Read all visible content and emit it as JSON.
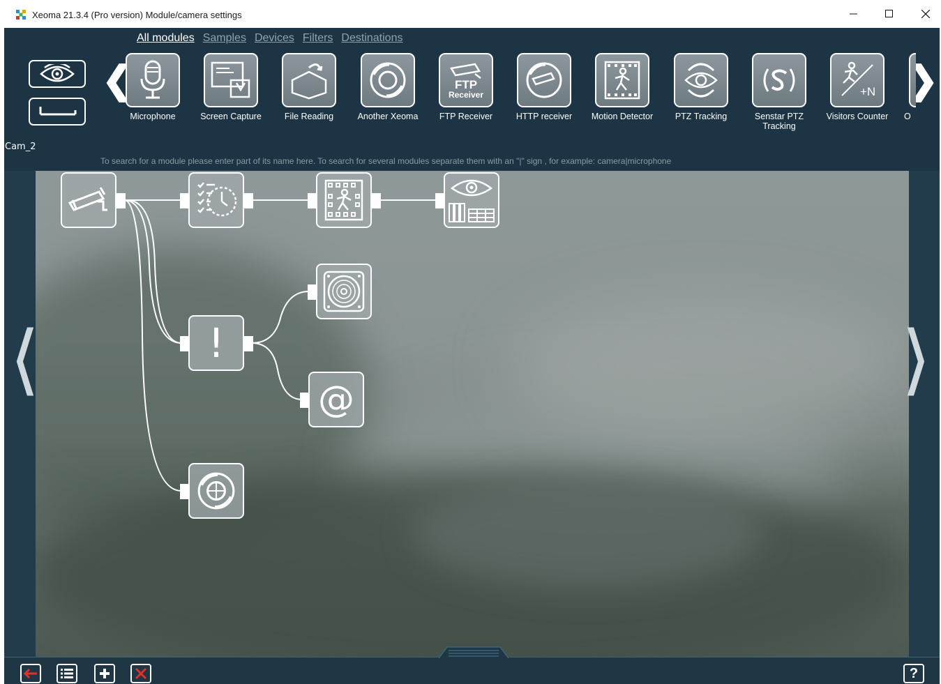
{
  "window": {
    "title": "Xeoma 21.3.4 (Pro version) Module/camera settings",
    "min_glyph": "–",
    "max_glyph": "☐",
    "close_glyph": "✕"
  },
  "tabs": [
    {
      "label": "All modules",
      "active": true
    },
    {
      "label": "Samples",
      "active": false
    },
    {
      "label": "Devices",
      "active": false
    },
    {
      "label": "Filters",
      "active": false
    },
    {
      "label": "Destinations",
      "active": false
    }
  ],
  "camera_name": "Cam_2",
  "modules": [
    {
      "label": "Microphone",
      "icon": "microphone-icon"
    },
    {
      "label": "Screen Capture",
      "icon": "screen-capture-icon"
    },
    {
      "label": "File Reading",
      "icon": "file-reading-icon"
    },
    {
      "label": "Another Xeoma",
      "icon": "another-xeoma-icon"
    },
    {
      "label": "FTP Receiver",
      "icon": "ftp-receiver-icon"
    },
    {
      "label": "HTTP receiver",
      "icon": "http-receiver-icon"
    },
    {
      "label": "Motion Detector",
      "icon": "motion-detector-icon"
    },
    {
      "label": "PTZ Tracking",
      "icon": "ptz-tracking-icon"
    },
    {
      "label": "Senstar PTZ Tracking",
      "icon": "senstar-ptz-icon"
    },
    {
      "label": "Visitors Counter",
      "icon": "visitors-counter-icon"
    },
    {
      "label": "O",
      "icon": "partial-module-icon"
    }
  ],
  "ftp_icon_text": {
    "line1": "FTP",
    "line2": "Receiver"
  },
  "visitors_icon_text": "+N",
  "search_hint": "To search for a module please enter part of its name here. To search for several modules separate them with an \"|\" sign , for example: camera|microphone",
  "graph_nodes": [
    {
      "name": "camera-node",
      "icon": "camera-icon"
    },
    {
      "name": "scheduler-node",
      "icon": "scheduler-icon"
    },
    {
      "name": "motion-detector-node",
      "icon": "motion-detector-icon"
    },
    {
      "name": "preview-archive-node",
      "icon": "preview-archive-icon"
    },
    {
      "name": "sound-alarm-node",
      "icon": "speaker-icon"
    },
    {
      "name": "problems-detector-node",
      "icon": "exclamation-icon"
    },
    {
      "name": "email-node",
      "icon": "at-sign-icon"
    },
    {
      "name": "another-xeoma-node",
      "icon": "another-xeoma-icon"
    }
  ],
  "email_glyph": "@",
  "exclamation_glyph": "!",
  "bottom_buttons": [
    {
      "icon": "back-arrow-icon"
    },
    {
      "icon": "list-icon"
    },
    {
      "icon": "plus-icon"
    },
    {
      "icon": "delete-icon"
    }
  ],
  "help_label": "?",
  "colors": {
    "frame": "#233c4b",
    "accent_red": "#e0302a",
    "text_muted": "#8ea3ad"
  }
}
